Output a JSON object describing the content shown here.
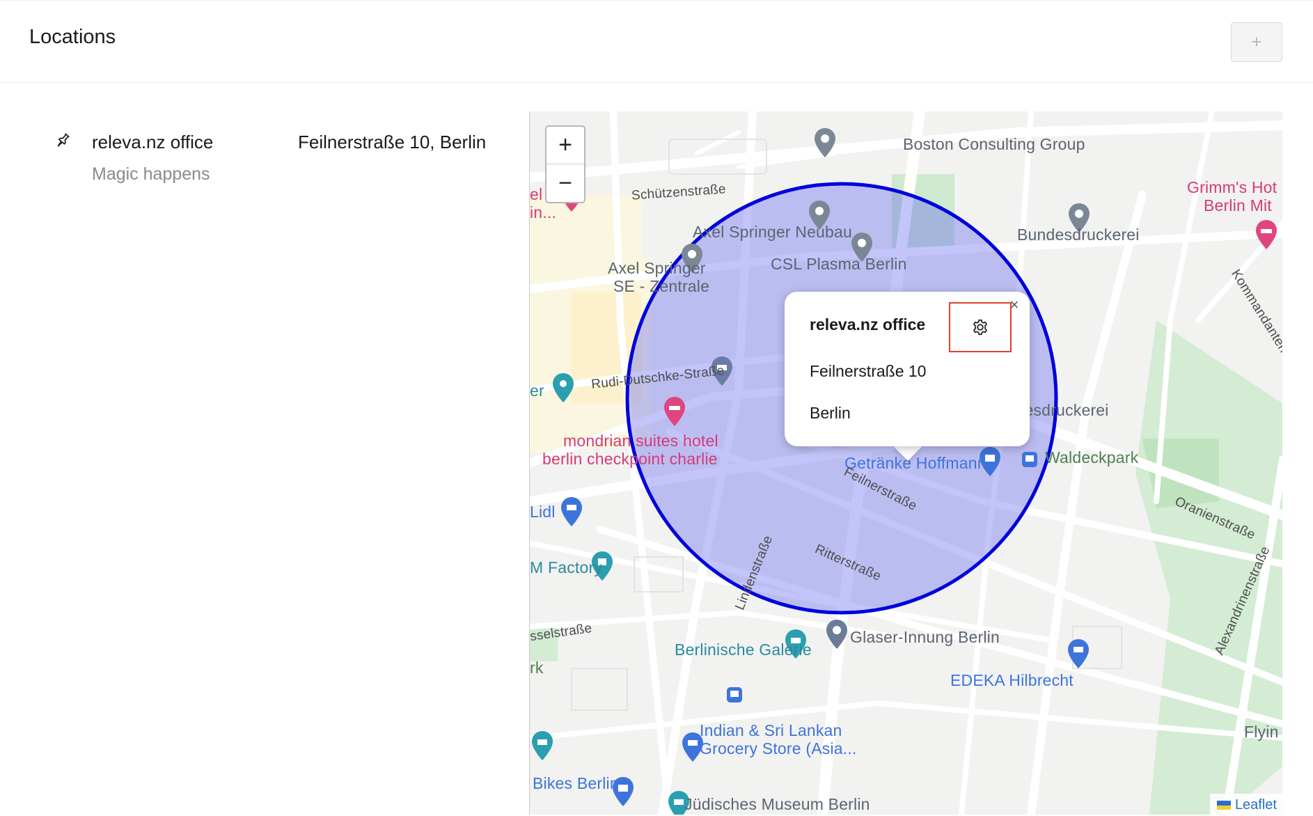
{
  "header": {
    "title": "Locations",
    "add_label": "+"
  },
  "locations": [
    {
      "name": "releva.nz office",
      "description": "Magic happens",
      "address": "Feilnerstraße 10, Berlin"
    }
  ],
  "map": {
    "zoom_in_label": "+",
    "zoom_out_label": "−",
    "attribution": "Leaflet",
    "circle_color": "#0000dd",
    "circle_fill": "#5a5ff0",
    "poi_labels": {
      "boston": "Boston Consulting Group",
      "grimms_1": "Grimm's Hot",
      "grimms_2": "Berlin Mit",
      "axel_neubau": "Axel Springer Neubau",
      "bundesdruckerei_top": "Bundesdruckerei",
      "csl": "CSL Plasma Berlin",
      "axel_se_1": "Axel Springer",
      "axel_se_2": "SE - Zentrale",
      "el_in_1": "el",
      "el_in_2": "in...",
      "er": "er",
      "mondrian_1": "mondrian suites hotel",
      "mondrian_2": "berlin checkpoint charlie",
      "bundesdruckerei_right": "Bundesdruckerei",
      "getraenke": "Getränke Hoffmann",
      "waldeckpark": "Waldeckpark",
      "lidl": "Lidl",
      "factory": "M Factory",
      "glaser": "Glaser-Innung Berlin",
      "galerie": "Berlinische Galerie",
      "edeka": "EDEKA Hilbrecht",
      "flyin": "Flyin",
      "indian_1": "Indian & Sri Lankan",
      "indian_2": "Grocery Store (Asia...",
      "bikes": "Bikes Berlin",
      "juedisches": "Jüdisches Museum Berlin",
      "rk": "rk"
    },
    "streets": {
      "schuetzen": "Schützenstraße",
      "rudi": "Rudi-Dutschke-Straße",
      "feilner": "Feilnerstraße",
      "ritter": "Ritterstraße",
      "linden": "Lindenstraße",
      "oranien": "Oranienstraße",
      "kommandanten": "Kommandantenstra",
      "alexandrinen": "Alexandrinenstraße",
      "essel": "sselstraße"
    }
  },
  "popup": {
    "title": "releva.nz office",
    "street": "Feilnerstraße 10",
    "city": "Berlin",
    "close_label": "×"
  }
}
